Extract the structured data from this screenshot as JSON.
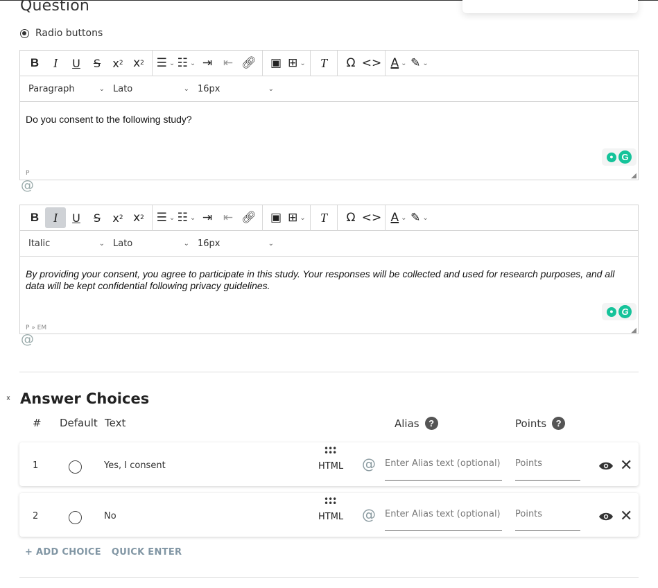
{
  "question": {
    "title": "Question",
    "type_label": "Radio buttons"
  },
  "toolbar": {
    "bold": "B",
    "italic": "I",
    "underline": "U",
    "strike": "S",
    "superscript": "x",
    "subscript": "x",
    "clear_format": "T",
    "special_char": "Ω",
    "code": "<>",
    "font_color": "A"
  },
  "editor1": {
    "format": "Paragraph",
    "font": "Lato",
    "size": "16px",
    "content": "Do you consent to the following study?",
    "status": "P"
  },
  "editor2": {
    "format": "Italic",
    "font": "Lato",
    "size": "16px",
    "content": "By providing your consent, you agree to participate in this study. Your responses will be collected and used for research purposes, and all data will be kept confidential following privacy guidelines.",
    "status": "P » EM"
  },
  "at_symbol": "@",
  "answer_choices": {
    "title": "Answer Choices",
    "headers": {
      "num": "#",
      "default": "Default",
      "text": "Text",
      "alias": "Alias",
      "points": "Points"
    },
    "help_glyph": "?",
    "choices": [
      {
        "num": "1",
        "text": "Yes, I consent",
        "html_label": "HTML",
        "alias_placeholder": "Enter Alias text (optional)",
        "points_placeholder": "Points"
      },
      {
        "num": "2",
        "text": "No",
        "html_label": "HTML",
        "alias_placeholder": "Enter Alias text (optional)",
        "points_placeholder": "Points"
      }
    ],
    "add_choice": "+ ADD CHOICE",
    "quick_enter": "QUICK ENTER"
  },
  "colors": {
    "accent_link": "#8196a4",
    "grammarly": "#15c39a",
    "toolbar_active": "#cfd2d6"
  }
}
